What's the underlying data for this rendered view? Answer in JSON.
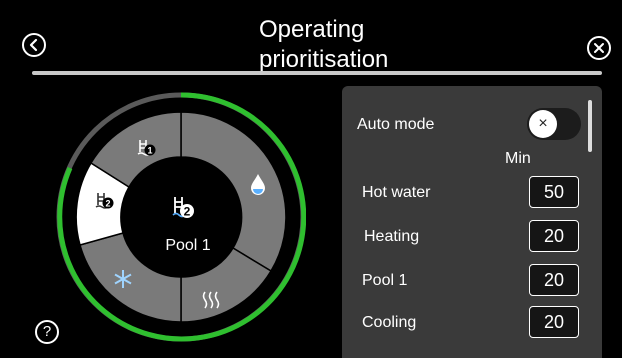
{
  "header": {
    "title_line1": "Operating",
    "title_line2": "prioritisation"
  },
  "wheel": {
    "center_label": "Pool 1",
    "ring_progress_color": "#2fbf2f",
    "segments": [
      {
        "name": "pool-1",
        "icon": "pool-1-icon",
        "selected": false
      },
      {
        "name": "hot-water",
        "icon": "water-drop-icon",
        "selected": false
      },
      {
        "name": "heating",
        "icon": "heating-icon",
        "selected": false
      },
      {
        "name": "cooling",
        "icon": "snowflake-icon",
        "selected": false
      },
      {
        "name": "pool-2",
        "icon": "pool-2-icon",
        "selected": true
      }
    ]
  },
  "panel": {
    "auto_mode_label": "Auto mode",
    "auto_mode_on": false,
    "auto_mode_knob_glyph": "×",
    "min_label": "Min",
    "rows": [
      {
        "label": "Hot water",
        "value": "50"
      },
      {
        "label": "Heating",
        "value": "20"
      },
      {
        "label": "Pool 1",
        "value": "20"
      },
      {
        "label": "Cooling",
        "value": "20"
      }
    ]
  },
  "footer": {
    "help_glyph": "?"
  }
}
